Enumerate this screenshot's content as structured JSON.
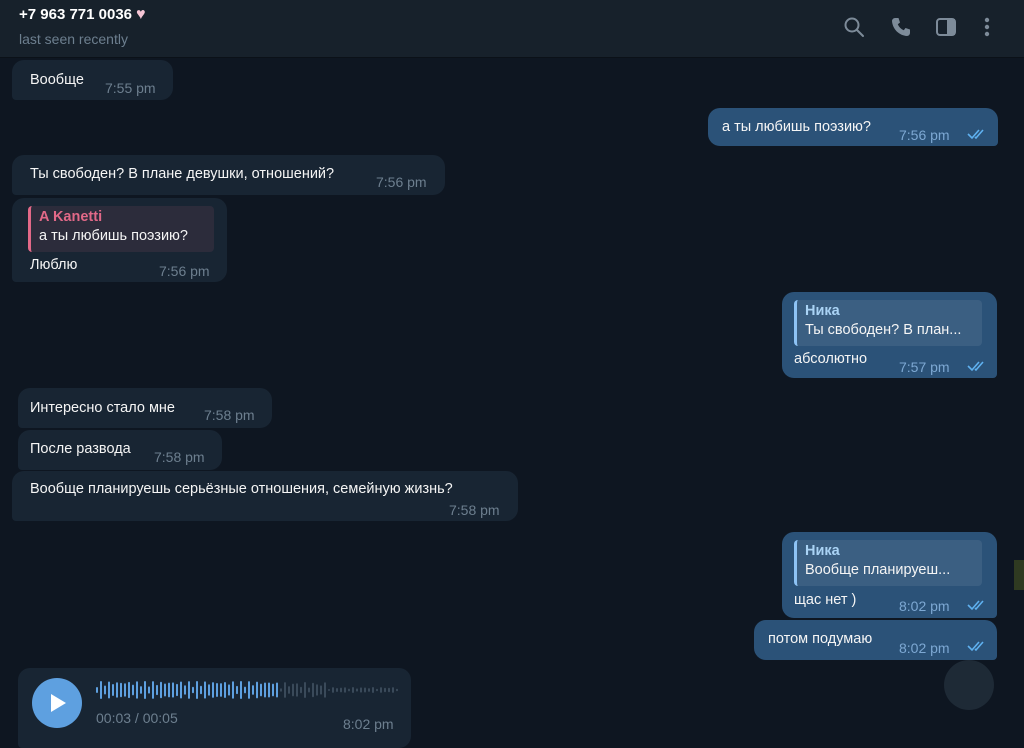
{
  "header": {
    "title": "+7 963 771 0036",
    "status": "last seen recently",
    "icons": [
      "search-icon",
      "phone-icon",
      "sidebar-toggle-icon",
      "more-vertical-icon"
    ]
  },
  "messages": [
    {
      "dir": "in",
      "text": "Вообще",
      "time": "7:55 pm"
    },
    {
      "dir": "out",
      "text": "а ты любишь поэзию?",
      "time": "7:56 pm"
    },
    {
      "dir": "in",
      "text": "Ты свободен? В плане девушки, отношений?",
      "time": "7:56 pm"
    },
    {
      "dir": "in",
      "reply_author": "A Kanetti",
      "reply_text": "а ты любишь поэзию?",
      "text": "Люблю",
      "time": "7:56 pm"
    },
    {
      "dir": "out",
      "reply_author": "Ника",
      "reply_text": "Ты свободен? В план...",
      "text": "абсолютно",
      "time": "7:57 pm"
    },
    {
      "dir": "in",
      "text": "Интересно стало мне",
      "time": "7:58 pm"
    },
    {
      "dir": "in",
      "text": "После развода",
      "time": "7:58 pm"
    },
    {
      "dir": "in",
      "text": "Вообще планируешь серьёзные отношения, семейную жизнь?",
      "time": "7:58 pm"
    },
    {
      "dir": "out",
      "reply_author": "Ника",
      "reply_text": "Вообще планируеш...",
      "text": "щас нет )",
      "time": "8:02 pm"
    },
    {
      "dir": "out",
      "text": "потом подумаю",
      "time": "8:02 pm"
    }
  ],
  "voice": {
    "progress": "00:03 / 00:05",
    "time": "8:02 pm",
    "played_fraction": 0.6
  },
  "colors": {
    "background": "#0e1621",
    "incoming_bubble": "#182533",
    "outgoing_bubble": "#2b5278",
    "read_check": "#5fb1f0",
    "reply_in_accent": "#e26988"
  }
}
